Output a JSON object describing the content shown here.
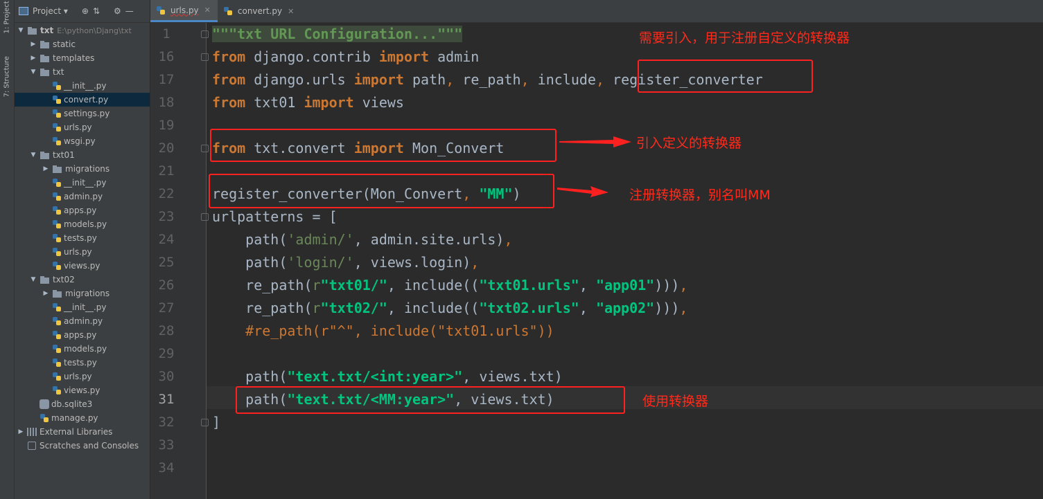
{
  "sidebar_tabs": {
    "project": "1: Project",
    "structure": "7: Structure"
  },
  "panel": {
    "title": "Project"
  },
  "tree": [
    {
      "label": "txt",
      "extra": "E:\\python\\Djang\\txt",
      "level": 0,
      "kind": "folder",
      "expand": "▼",
      "bold": true
    },
    {
      "label": "static",
      "level": 1,
      "kind": "folder",
      "expand": "▶"
    },
    {
      "label": "templates",
      "level": 1,
      "kind": "folder",
      "expand": "▶"
    },
    {
      "label": "txt",
      "level": 1,
      "kind": "folder",
      "expand": "▼"
    },
    {
      "label": "__init__.py",
      "level": 2,
      "kind": "py"
    },
    {
      "label": "convert.py",
      "level": 2,
      "kind": "py",
      "selected": true
    },
    {
      "label": "settings.py",
      "level": 2,
      "kind": "py"
    },
    {
      "label": "urls.py",
      "level": 2,
      "kind": "py"
    },
    {
      "label": "wsgi.py",
      "level": 2,
      "kind": "py"
    },
    {
      "label": "txt01",
      "level": 1,
      "kind": "folder",
      "expand": "▼"
    },
    {
      "label": "migrations",
      "level": 2,
      "kind": "folder",
      "expand": "▶"
    },
    {
      "label": "__init__.py",
      "level": 2,
      "kind": "py"
    },
    {
      "label": "admin.py",
      "level": 2,
      "kind": "py"
    },
    {
      "label": "apps.py",
      "level": 2,
      "kind": "py"
    },
    {
      "label": "models.py",
      "level": 2,
      "kind": "py"
    },
    {
      "label": "tests.py",
      "level": 2,
      "kind": "py"
    },
    {
      "label": "urls.py",
      "level": 2,
      "kind": "py"
    },
    {
      "label": "views.py",
      "level": 2,
      "kind": "py"
    },
    {
      "label": "txt02",
      "level": 1,
      "kind": "folder",
      "expand": "▼"
    },
    {
      "label": "migrations",
      "level": 2,
      "kind": "folder",
      "expand": "▶"
    },
    {
      "label": "__init__.py",
      "level": 2,
      "kind": "py"
    },
    {
      "label": "admin.py",
      "level": 2,
      "kind": "py"
    },
    {
      "label": "apps.py",
      "level": 2,
      "kind": "py"
    },
    {
      "label": "models.py",
      "level": 2,
      "kind": "py"
    },
    {
      "label": "tests.py",
      "level": 2,
      "kind": "py"
    },
    {
      "label": "urls.py",
      "level": 2,
      "kind": "py"
    },
    {
      "label": "views.py",
      "level": 2,
      "kind": "py"
    },
    {
      "label": "db.sqlite3",
      "level": 1,
      "kind": "db"
    },
    {
      "label": "manage.py",
      "level": 1,
      "kind": "py"
    },
    {
      "label": "External Libraries",
      "level": 0,
      "kind": "lib",
      "expand": "▶"
    },
    {
      "label": "Scratches and Consoles",
      "level": 0,
      "kind": "scratch"
    }
  ],
  "tabs": [
    {
      "label": "urls.py",
      "active": true
    },
    {
      "label": "convert.py",
      "active": false
    }
  ],
  "line_numbers": [
    "1",
    "16",
    "17",
    "18",
    "19",
    "20",
    "21",
    "22",
    "23",
    "24",
    "25",
    "26",
    "27",
    "28",
    "29",
    "30",
    "31",
    "32",
    "33",
    "34"
  ],
  "current_line": "31",
  "code": [
    [
      {
        "t": "\"\"\"txt URL Configuration...\"\"\"",
        "c": "doc"
      }
    ],
    [
      {
        "t": "from",
        "c": "kw"
      },
      {
        "t": " django.contrib "
      },
      {
        "t": "import",
        "c": "kw"
      },
      {
        "t": " admin"
      }
    ],
    [
      {
        "t": "from",
        "c": "kw"
      },
      {
        "t": " django.urls "
      },
      {
        "t": "import",
        "c": "kw"
      },
      {
        "t": " path"
      },
      {
        "t": ",",
        "c": "cm"
      },
      {
        "t": " re_path"
      },
      {
        "t": ",",
        "c": "cm"
      },
      {
        "t": " include"
      },
      {
        "t": ",",
        "c": "cm"
      },
      {
        "t": " register_converter"
      }
    ],
    [
      {
        "t": "from",
        "c": "kw"
      },
      {
        "t": " txt01 "
      },
      {
        "t": "import",
        "c": "kw"
      },
      {
        "t": " views"
      }
    ],
    [],
    [
      {
        "t": "from",
        "c": "kw"
      },
      {
        "t": " txt.convert "
      },
      {
        "t": "import",
        "c": "kw"
      },
      {
        "t": " Mon_Convert"
      }
    ],
    [],
    [
      {
        "t": "register_converter(Mon_Convert"
      },
      {
        "t": ",",
        "c": "cm"
      },
      {
        "t": " "
      },
      {
        "t": "\"MM\"",
        "c": "strs"
      },
      {
        "t": ")"
      }
    ],
    [
      {
        "t": "urlpatterns = ["
      }
    ],
    [
      {
        "t": "    path("
      },
      {
        "t": "'admin/'",
        "c": "str"
      },
      {
        "t": ","
      },
      {
        "t": " admin.site.urls)"
      },
      {
        "t": ",",
        "c": "cm"
      }
    ],
    [
      {
        "t": "    path("
      },
      {
        "t": "'login/'",
        "c": "str"
      },
      {
        "t": ","
      },
      {
        "t": " views.login)"
      },
      {
        "t": ",",
        "c": "cm"
      }
    ],
    [
      {
        "t": "    re_path("
      },
      {
        "t": "r",
        "c": "str"
      },
      {
        "t": "\"txt01/\"",
        "c": "strs"
      },
      {
        "t": ","
      },
      {
        "t": " include(("
      },
      {
        "t": "\"txt01.urls\"",
        "c": "strs"
      },
      {
        "t": ","
      },
      {
        "t": " "
      },
      {
        "t": "\"app01\"",
        "c": "strs"
      },
      {
        "t": ")))"
      },
      {
        "t": ",",
        "c": "cm"
      }
    ],
    [
      {
        "t": "    re_path("
      },
      {
        "t": "r",
        "c": "str"
      },
      {
        "t": "\"txt02/\"",
        "c": "strs"
      },
      {
        "t": ","
      },
      {
        "t": " include(("
      },
      {
        "t": "\"txt02.urls\"",
        "c": "strs"
      },
      {
        "t": ","
      },
      {
        "t": " "
      },
      {
        "t": "\"app02\"",
        "c": "strs"
      },
      {
        "t": ")))"
      },
      {
        "t": ",",
        "c": "cm"
      }
    ],
    [
      {
        "t": "    #re_path(r\"^\", include(\"txt01.urls\"))",
        "c": "cm"
      }
    ],
    [],
    [
      {
        "t": "    path("
      },
      {
        "t": "\"text.txt/<int:year>\"",
        "c": "strs"
      },
      {
        "t": ","
      },
      {
        "t": " views.txt)"
      }
    ],
    [
      {
        "t": "    path("
      },
      {
        "t": "\"text.txt/<MM:year>\"",
        "c": "strs"
      },
      {
        "t": ","
      },
      {
        "t": " views.txt)"
      }
    ],
    [
      {
        "t": "]"
      }
    ],
    [],
    []
  ],
  "annotations": {
    "a1": "需要引入，用于注册自定义的转换器",
    "a2": "引入定义的转换器",
    "a3": "注册转换器，别名叫MM",
    "a4": "使用转换器"
  },
  "colors": {
    "accent_red": "#ff2020",
    "keyword": "#cc7832",
    "string": "#6a8759"
  }
}
